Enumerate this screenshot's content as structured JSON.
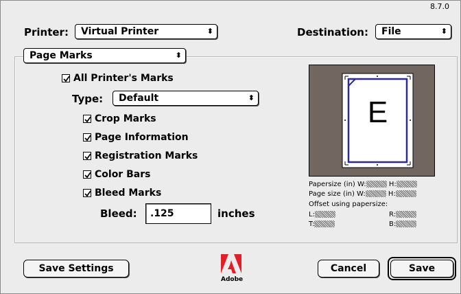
{
  "version": "8.7.0",
  "printer": {
    "label": "Printer:",
    "value": "Virtual Printer"
  },
  "destination": {
    "label": "Destination:",
    "value": "File"
  },
  "section": {
    "value": "Page Marks"
  },
  "marks": {
    "all_printers_marks": {
      "label": "All Printer's Marks",
      "checked": true
    },
    "type": {
      "label": "Type:",
      "value": "Default"
    },
    "items": [
      {
        "label": "Crop Marks",
        "checked": true
      },
      {
        "label": "Page Information",
        "checked": true
      },
      {
        "label": "Registration Marks",
        "checked": true
      },
      {
        "label": "Color Bars",
        "checked": true
      },
      {
        "label": "Bleed Marks",
        "checked": true
      }
    ],
    "bleed": {
      "label": "Bleed:",
      "value": ".125",
      "unit": "inches"
    }
  },
  "preview": {
    "glyph": "E",
    "papersize_label": "Papersize (in) W:",
    "pagesize_label": "Page size  (in) W:",
    "height_label": "H:",
    "offset_label": "Offset using papersize:",
    "left_label": "L:",
    "right_label": "R:",
    "top_label": "T:",
    "bottom_label": "B:"
  },
  "buttons": {
    "save_settings": "Save Settings",
    "cancel": "Cancel",
    "save": "Save"
  },
  "logo": {
    "text": "Adobe",
    "color": "#e21f26"
  }
}
